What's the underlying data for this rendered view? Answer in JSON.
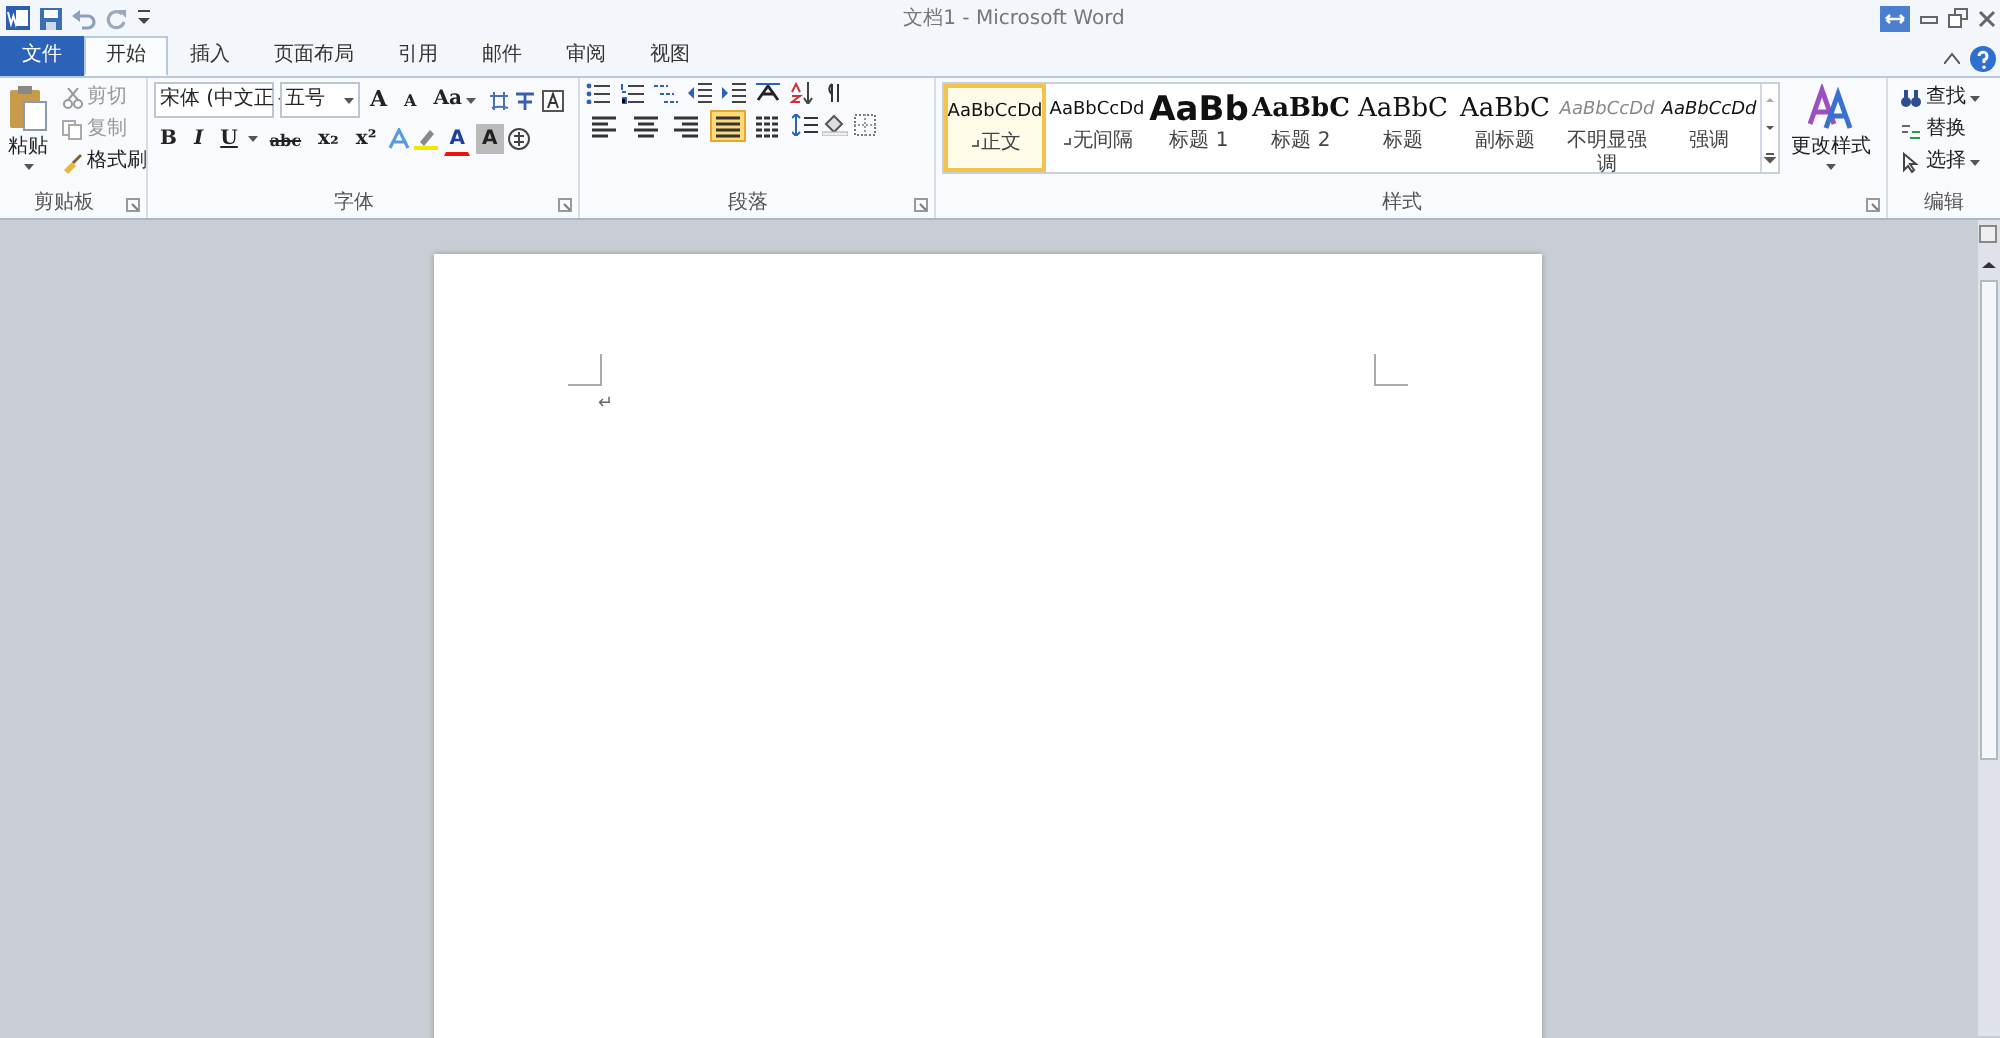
{
  "title_bar": {
    "title": "文档1 - Microsoft Word"
  },
  "tabs": [
    {
      "label": "文件",
      "kind": "file",
      "selected": false
    },
    {
      "label": "开始",
      "kind": "tab",
      "selected": true
    },
    {
      "label": "插入",
      "kind": "tab",
      "selected": false
    },
    {
      "label": "页面布局",
      "kind": "tab",
      "selected": false
    },
    {
      "label": "引用",
      "kind": "tab",
      "selected": false
    },
    {
      "label": "邮件",
      "kind": "tab",
      "selected": false
    },
    {
      "label": "审阅",
      "kind": "tab",
      "selected": false
    },
    {
      "label": "视图",
      "kind": "tab",
      "selected": false
    }
  ],
  "clipboard": {
    "paste": "粘贴",
    "label": "剪贴板",
    "actions": [
      {
        "label": "剪切",
        "disabled": true
      },
      {
        "label": "复制",
        "disabled": true
      },
      {
        "label": "格式刷",
        "disabled": false
      }
    ]
  },
  "font": {
    "label": "字体",
    "font_name": "宋体 (中文正",
    "font_size": "五号",
    "grow": "A",
    "shrink": "A",
    "change_case": "Aa",
    "format_buttons": [
      "B",
      "I",
      "U",
      "abc",
      "x₂",
      "x²"
    ],
    "font_color": "A",
    "char_shading": "A"
  },
  "paragraph": {
    "label": "段落",
    "alignments": [
      {
        "selected": false
      },
      {
        "selected": false
      },
      {
        "selected": false
      },
      {
        "selected": true
      },
      {
        "selected": false
      }
    ]
  },
  "styles": {
    "label": "样式",
    "change_styles": "更改样式",
    "items": [
      {
        "preview": "AaBbCcDd",
        "name": "正文",
        "kind": "normal",
        "selected": true
      },
      {
        "preview": "AaBbCcDd",
        "name": "无间隔",
        "kind": "normal",
        "selected": false
      },
      {
        "preview": "AaBb",
        "name": "标题 1",
        "kind": "heading1",
        "selected": false
      },
      {
        "preview": "AaBbC",
        "name": "标题 2",
        "kind": "heading2",
        "selected": false
      },
      {
        "preview": "AaBbC",
        "name": "标题",
        "kind": "title",
        "selected": false
      },
      {
        "preview": "AaBbC",
        "name": "副标题",
        "kind": "title",
        "selected": false
      },
      {
        "preview": "AaBbCcDd",
        "name": "不明显强调",
        "kind": "subtle",
        "selected": false
      },
      {
        "preview": "AaBbCcDd",
        "name": "强调",
        "kind": "emphasis",
        "selected": false
      }
    ]
  },
  "editing": {
    "label": "编辑",
    "items": [
      {
        "label": "查找",
        "dropdown": true
      },
      {
        "label": "替换",
        "dropdown": false
      },
      {
        "label": "选择",
        "dropdown": true
      }
    ]
  },
  "document": {
    "paragraph_mark": "↵"
  }
}
